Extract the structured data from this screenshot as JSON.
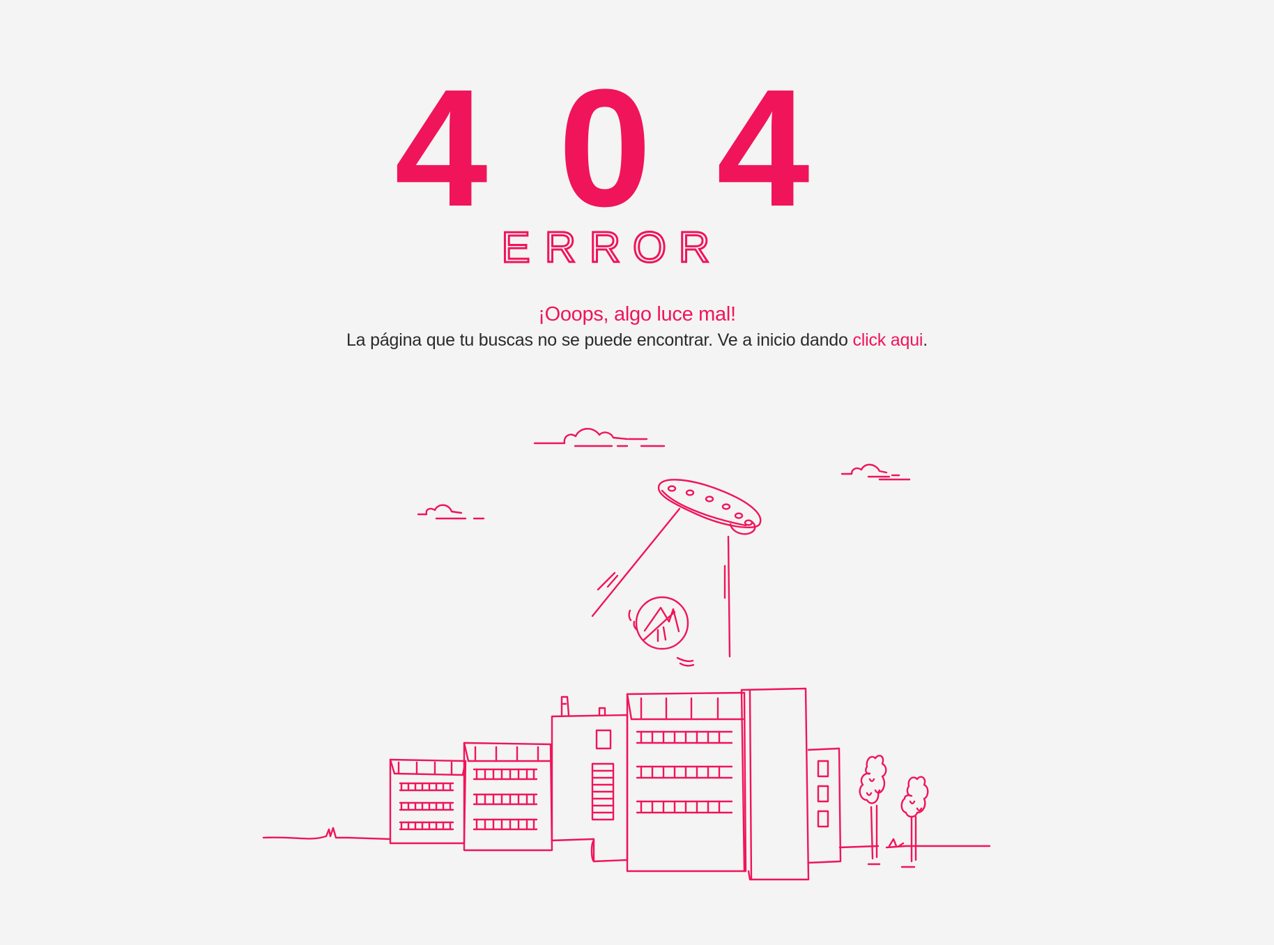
{
  "error": {
    "code_digits": [
      "4",
      "0",
      "4"
    ],
    "word_letters": [
      "E",
      "R",
      "R",
      "O",
      "R"
    ]
  },
  "message": {
    "headline": "¡Ooops, algo luce mal!",
    "description_before": "La página que tu buscas no se puede encontrar. Ve a inicio dando ",
    "link_label": "click aqui",
    "description_after": "."
  },
  "colors": {
    "accent": "#f0145a",
    "text": "#2a2a2a",
    "background": "#f4f4f4"
  },
  "illustration": {
    "icons": [
      "ufo-icon",
      "logo-badge-icon",
      "building-icon",
      "tree-icon",
      "cloud-icon"
    ]
  }
}
